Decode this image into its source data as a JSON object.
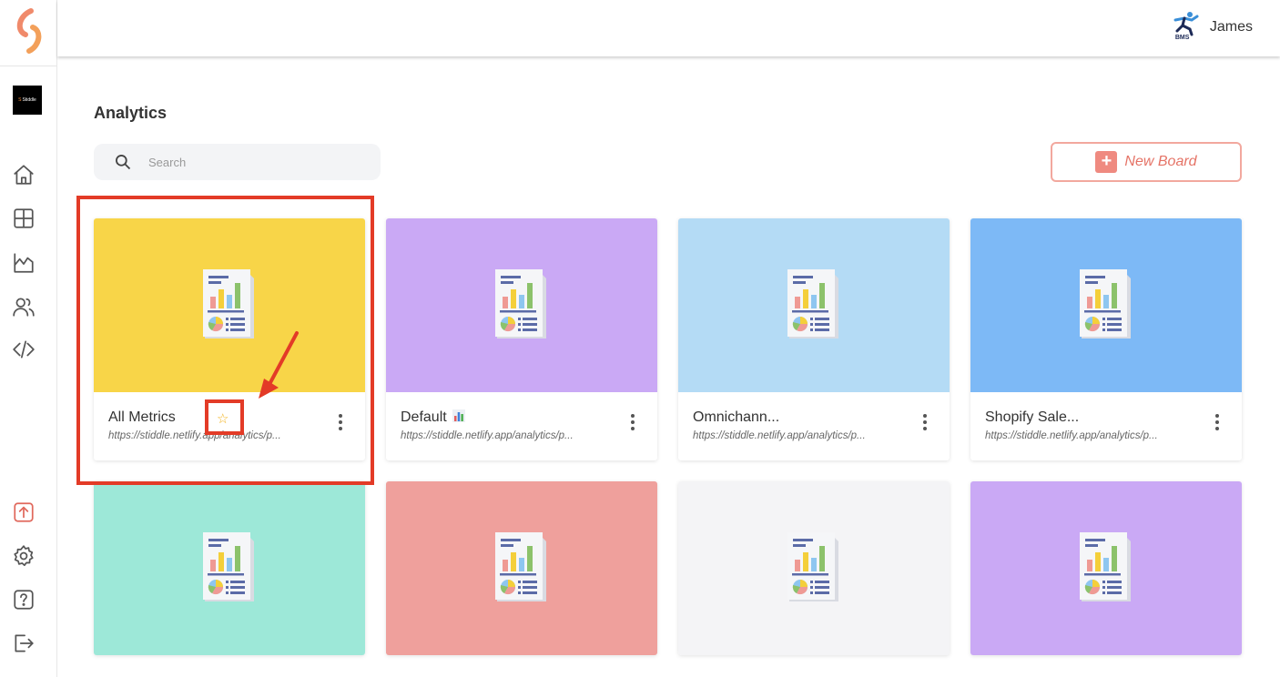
{
  "topbar": {
    "user_name": "James",
    "org_logo_text": "BMS"
  },
  "sidebar": {
    "workspace_label": "Stiddle",
    "items": [
      {
        "icon": "home-icon"
      },
      {
        "icon": "dashboard-icon"
      },
      {
        "icon": "analytics-icon"
      },
      {
        "icon": "users-icon"
      },
      {
        "icon": "code-icon"
      },
      {
        "icon": "upload-icon"
      },
      {
        "icon": "settings-icon"
      },
      {
        "icon": "help-icon"
      },
      {
        "icon": "logout-icon"
      }
    ]
  },
  "page": {
    "title": "Analytics"
  },
  "search": {
    "placeholder": "Search",
    "value": ""
  },
  "new_board": {
    "label": "New Board"
  },
  "boards": [
    {
      "title": "All Metrics",
      "url": "https://stiddle.netlify.app/analytics/p...",
      "color": "#f8d548",
      "starred": true
    },
    {
      "title": "Default",
      "url": "https://stiddle.netlify.app/analytics/p...",
      "color": "#caa9f5",
      "emoji": "bar-chart-icon"
    },
    {
      "title": "Omnichann...",
      "url": "https://stiddle.netlify.app/analytics/p...",
      "color": "#b4dbf5"
    },
    {
      "title": "Shopify Sale...",
      "url": "https://stiddle.netlify.app/analytics/p...",
      "color": "#7db9f6"
    },
    {
      "color": "#9de8d8"
    },
    {
      "color": "#efa09c"
    },
    {
      "color": "#f4f4f6"
    },
    {
      "color": "#caa9f5"
    }
  ],
  "annotation": {
    "color": "#e33b27"
  }
}
